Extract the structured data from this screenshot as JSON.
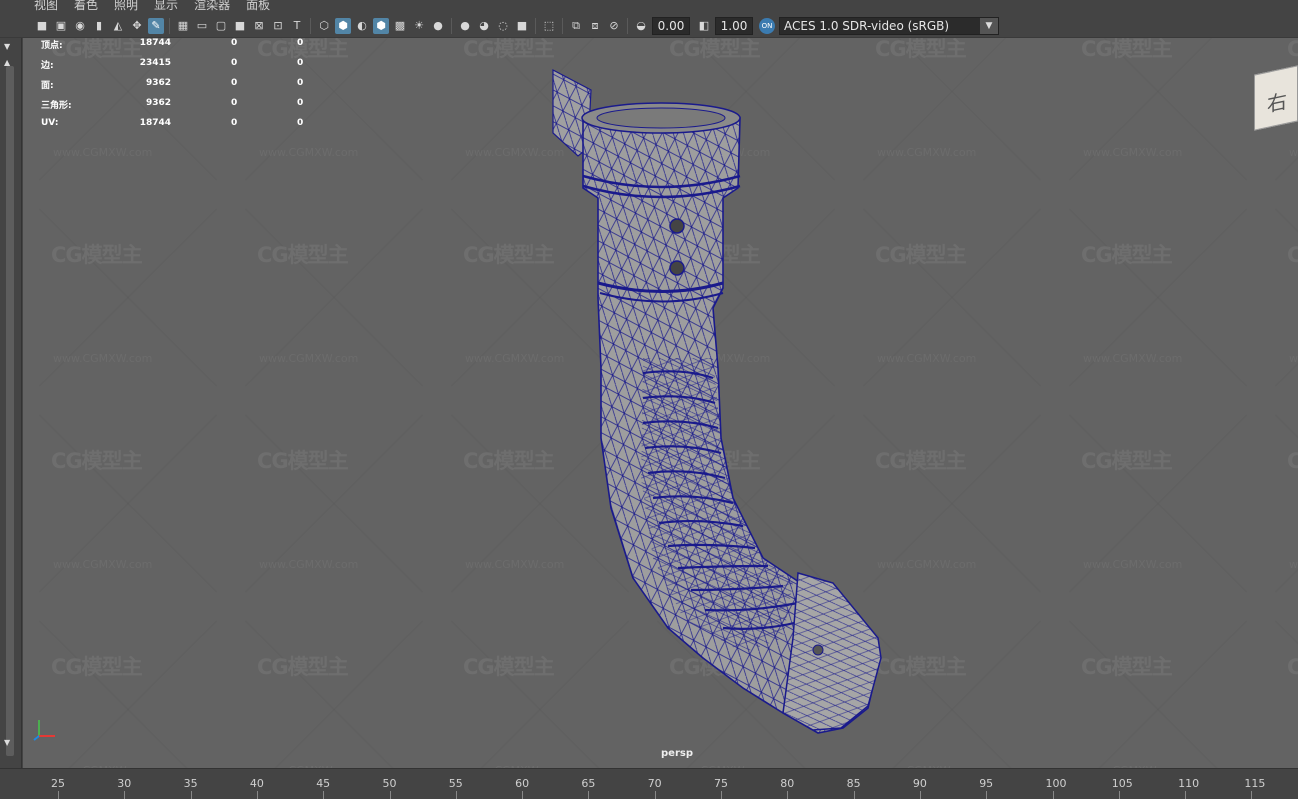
{
  "menu": [
    "视图",
    "着色",
    "照明",
    "显示",
    "渲染器",
    "面板"
  ],
  "toolbar": {
    "camera_near": "0.00",
    "exposure": "1.00",
    "color_mgmt_badge": "ON",
    "color_space": "ACES 1.0 SDR-video (sRGB)",
    "icons": [
      "camera-icon",
      "camera-lock-icon",
      "camera-attributes-icon",
      "bookmark-icon",
      "image-plane-icon",
      "grease-pencil-icon",
      "grid-icon",
      "film-gate-icon",
      "resolution-gate-icon",
      "gate-mask-icon",
      "field-chart-icon",
      "safe-action-icon",
      "safe-title-icon",
      "wireframe-icon",
      "smooth-shade-icon",
      "default-material-icon",
      "wireframe-on-shaded-icon",
      "textured-icon",
      "use-all-lights-icon",
      "shadows-icon",
      "screen-space-ao-icon",
      "motion-blur-icon",
      "anti-aliasing-icon",
      "depth-of-field-icon",
      "isolate-select-icon",
      "xray-icon",
      "xray-joints-icon",
      "xray-active-icon",
      "gamma-icon",
      "exposure-icon"
    ]
  },
  "hud": {
    "rows": [
      {
        "label": "顶点:",
        "v1": "18744",
        "v2": "0",
        "v3": "0"
      },
      {
        "label": "边:",
        "v1": "23415",
        "v2": "0",
        "v3": "0"
      },
      {
        "label": "面:",
        "v1": "9362",
        "v2": "0",
        "v3": "0"
      },
      {
        "label": "三角形:",
        "v1": "9362",
        "v2": "0",
        "v3": "0"
      },
      {
        "label": "UV:",
        "v1": "18744",
        "v2": "0",
        "v3": "0"
      }
    ]
  },
  "viewport": {
    "camera": "persp",
    "viewcube_face": "右",
    "watermark_logo": "CG模型主",
    "watermark_url": "www.CGMXW.com"
  },
  "timeline": {
    "ticks": [
      "25",
      "30",
      "35",
      "40",
      "45",
      "50",
      "55",
      "60",
      "65",
      "70",
      "75",
      "80",
      "85",
      "90",
      "95",
      "100",
      "105",
      "110",
      "115"
    ]
  },
  "colors": {
    "viewport_bg": "#636363",
    "wireframe": "#1a1a8c",
    "mesh_fill": "#a8a8a8",
    "active_icon": "#5285a6"
  }
}
